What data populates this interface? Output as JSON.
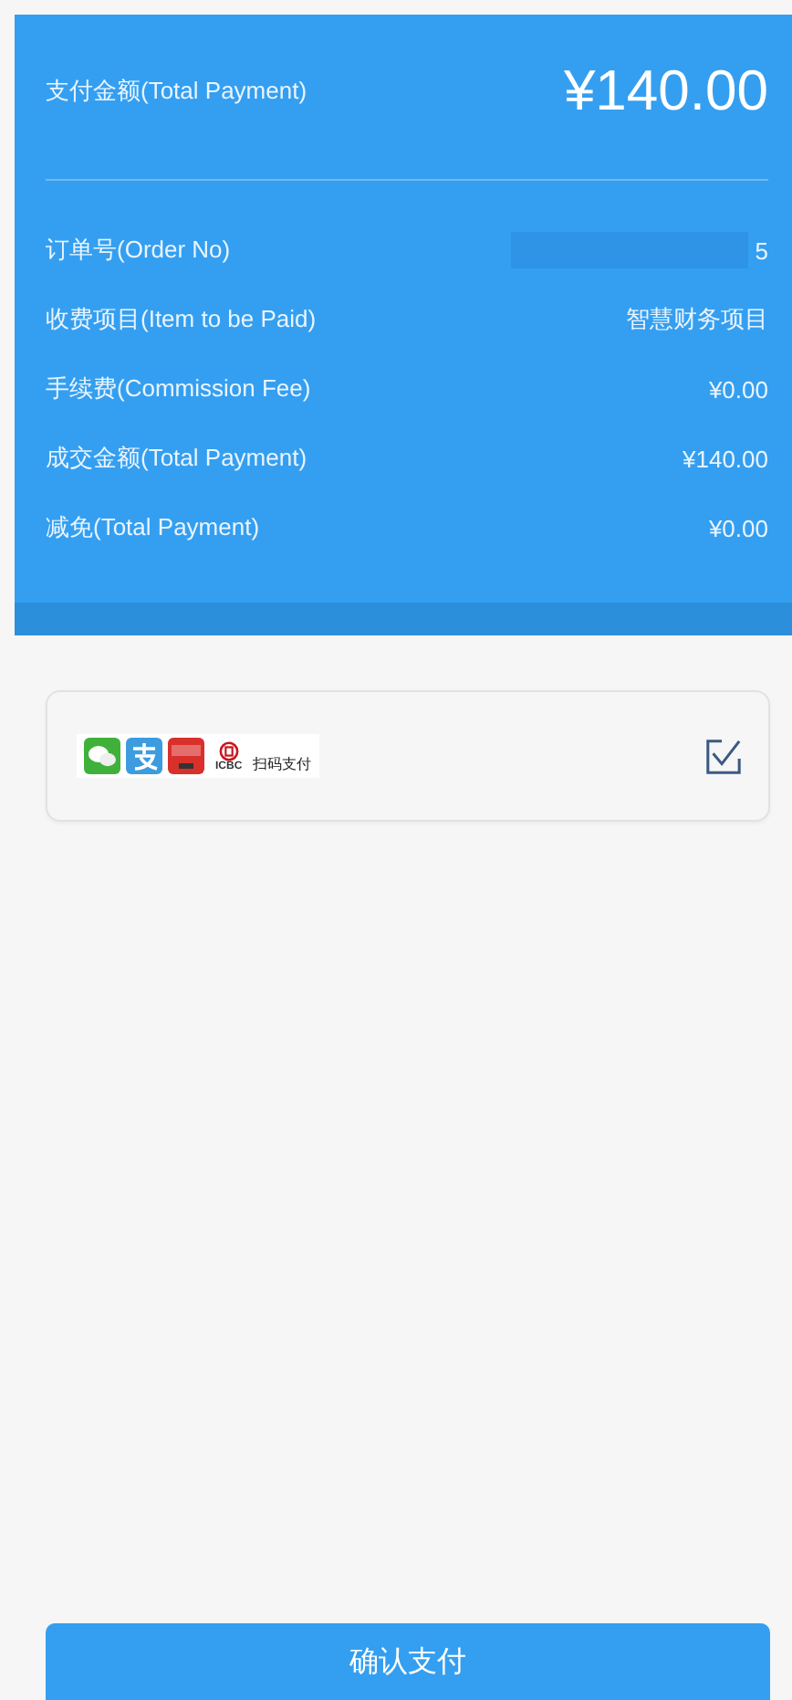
{
  "summary": {
    "label": "支付金额(Total Payment)",
    "amount": "¥140.00"
  },
  "details": [
    {
      "label": "订单号(Order No)",
      "value": "5",
      "redacted": true
    },
    {
      "label": "收费项目(Item to be Paid)",
      "value": "智慧财务项目",
      "redacted": false
    },
    {
      "label": "手续费(Commission Fee)",
      "value": "¥0.00",
      "redacted": false
    },
    {
      "label": "成交金额(Total Payment)",
      "value": "¥140.00",
      "redacted": false
    },
    {
      "label": "减免(Total Payment)",
      "value": "¥0.00",
      "redacted": false
    }
  ],
  "payment_option": {
    "bank_text": "ICBC",
    "method": "扫码支付",
    "checked": true
  },
  "confirm_button": "确认支付"
}
